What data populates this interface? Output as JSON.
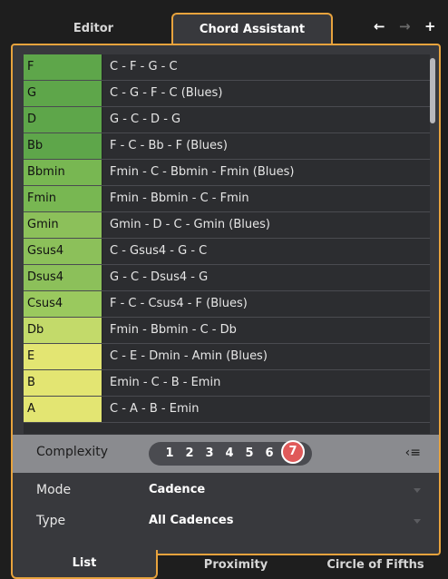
{
  "tabs_top": {
    "editor": "Editor",
    "chord_assistant": "Chord Assistant"
  },
  "nav": {
    "back_icon": "arrow-left-icon",
    "forward_icon": "arrow-right-icon",
    "add_icon": "plus-icon"
  },
  "rows": [
    {
      "chord": "F",
      "progression": "C - F - G - C",
      "color": "#5ea64a"
    },
    {
      "chord": "G",
      "progression": "C - G - F - C (Blues)",
      "color": "#5ea64a"
    },
    {
      "chord": "D",
      "progression": "G - C - D - G",
      "color": "#5ea64a"
    },
    {
      "chord": "Bb",
      "progression": "F - C - Bb - F (Blues)",
      "color": "#5ea64a"
    },
    {
      "chord": "Bbmin",
      "progression": "Fmin - C - Bbmin - Fmin (Blues)",
      "color": "#78b752"
    },
    {
      "chord": "Fmin",
      "progression": "Fmin - Bbmin - C - Fmin",
      "color": "#78b752"
    },
    {
      "chord": "Gmin",
      "progression": "Gmin - D - C - Gmin (Blues)",
      "color": "#8cc05a"
    },
    {
      "chord": "Gsus4",
      "progression": "C - Gsus4 - G - C",
      "color": "#8cc05a"
    },
    {
      "chord": "Dsus4",
      "progression": "G - C - Dsus4 - G",
      "color": "#8cc05a"
    },
    {
      "chord": "Csus4",
      "progression": "F - C - Csus4 - F (Blues)",
      "color": "#9ac95e"
    },
    {
      "chord": "Db",
      "progression": "Fmin - Bbmin - C - Db",
      "color": "#c3da6a"
    },
    {
      "chord": "E",
      "progression": "C - E - Dmin - Amin (Blues)",
      "color": "#e3e572"
    },
    {
      "chord": "B",
      "progression": "Emin - C - B - Emin",
      "color": "#e3e572"
    },
    {
      "chord": "A",
      "progression": "C - A - B - Emin",
      "color": "#e3e572"
    }
  ],
  "complexity": {
    "label": "Complexity",
    "levels": [
      "1",
      "2",
      "3",
      "4",
      "5",
      "6",
      "7"
    ],
    "selected": "7",
    "menu_icon": "list-menu-icon"
  },
  "mode": {
    "label": "Mode",
    "value": "Cadence"
  },
  "type": {
    "label": "Type",
    "value": "All Cadences"
  },
  "tabs_bottom": {
    "list": "List",
    "proximity": "Proximity",
    "circle": "Circle of Fifths"
  }
}
